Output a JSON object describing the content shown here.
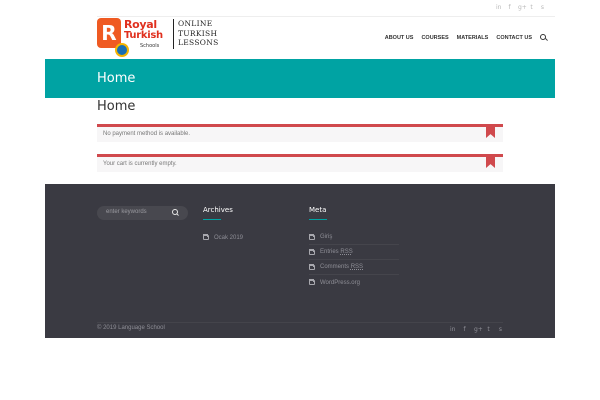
{
  "header": {
    "social": [
      "in",
      "f",
      "g+",
      "t",
      "s"
    ],
    "logo": {
      "initial": "R",
      "royal": "Royal",
      "turkish": "Turkish",
      "schools": "Schools",
      "tagline": [
        "ONLINE",
        "TURKISH",
        "LESSONS"
      ]
    },
    "nav": [
      {
        "label": "ABOUT US"
      },
      {
        "label": "COURSES"
      },
      {
        "label": "MATERIALS"
      },
      {
        "label": "CONTACT US"
      }
    ]
  },
  "title_band": {
    "title": "Home"
  },
  "page": {
    "title": "Home"
  },
  "notices": [
    {
      "text": "No payment method is available."
    },
    {
      "text": "Your cart is currently empty."
    }
  ],
  "footer": {
    "search": {
      "placeholder": "enter keywords"
    },
    "archives": {
      "title": "Archives",
      "items": [
        {
          "label": "Ocak 2019"
        }
      ]
    },
    "meta": {
      "title": "Meta",
      "items": [
        {
          "label": "Giriş",
          "rss": ""
        },
        {
          "label": "Entries",
          "rss": "RSS"
        },
        {
          "label": "Comments",
          "rss": "RSS"
        },
        {
          "label": "WordPress.org",
          "rss": ""
        }
      ]
    },
    "copyright": "© 2019 Language School",
    "social": [
      "in",
      "f",
      "g+",
      "t",
      "s"
    ]
  },
  "colors": {
    "accent": "#00a3a3",
    "notice": "#d0494d",
    "footer_bg": "#3a3a42",
    "brand": "#ef5a22"
  }
}
